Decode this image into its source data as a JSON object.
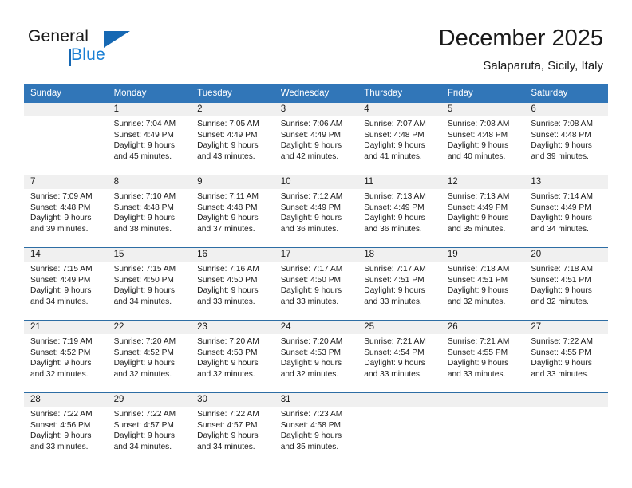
{
  "brand": {
    "name_part1": "General",
    "name_part2": "Blue",
    "logo_icon": "triangle-logo-icon"
  },
  "header": {
    "month_title": "December 2025",
    "location": "Salaparuta, Sicily, Italy"
  },
  "colors": {
    "header_blue": "#3176b8",
    "row_divider_blue": "#2d6da4",
    "daynum_band": "#f0f0f0",
    "brand_blue": "#1a7fd4",
    "logo_blue": "#1668b3"
  },
  "weekday_headers": [
    "Sunday",
    "Monday",
    "Tuesday",
    "Wednesday",
    "Thursday",
    "Friday",
    "Saturday"
  ],
  "weeks": [
    [
      {
        "day": "",
        "blank": true,
        "sunrise": "",
        "sunset": "",
        "daylight_line1": "",
        "daylight_line2": ""
      },
      {
        "day": "1",
        "sunrise": "Sunrise: 7:04 AM",
        "sunset": "Sunset: 4:49 PM",
        "daylight_line1": "Daylight: 9 hours",
        "daylight_line2": "and 45 minutes."
      },
      {
        "day": "2",
        "sunrise": "Sunrise: 7:05 AM",
        "sunset": "Sunset: 4:49 PM",
        "daylight_line1": "Daylight: 9 hours",
        "daylight_line2": "and 43 minutes."
      },
      {
        "day": "3",
        "sunrise": "Sunrise: 7:06 AM",
        "sunset": "Sunset: 4:49 PM",
        "daylight_line1": "Daylight: 9 hours",
        "daylight_line2": "and 42 minutes."
      },
      {
        "day": "4",
        "sunrise": "Sunrise: 7:07 AM",
        "sunset": "Sunset: 4:48 PM",
        "daylight_line1": "Daylight: 9 hours",
        "daylight_line2": "and 41 minutes."
      },
      {
        "day": "5",
        "sunrise": "Sunrise: 7:08 AM",
        "sunset": "Sunset: 4:48 PM",
        "daylight_line1": "Daylight: 9 hours",
        "daylight_line2": "and 40 minutes."
      },
      {
        "day": "6",
        "sunrise": "Sunrise: 7:08 AM",
        "sunset": "Sunset: 4:48 PM",
        "daylight_line1": "Daylight: 9 hours",
        "daylight_line2": "and 39 minutes."
      }
    ],
    [
      {
        "day": "7",
        "sunrise": "Sunrise: 7:09 AM",
        "sunset": "Sunset: 4:48 PM",
        "daylight_line1": "Daylight: 9 hours",
        "daylight_line2": "and 39 minutes."
      },
      {
        "day": "8",
        "sunrise": "Sunrise: 7:10 AM",
        "sunset": "Sunset: 4:48 PM",
        "daylight_line1": "Daylight: 9 hours",
        "daylight_line2": "and 38 minutes."
      },
      {
        "day": "9",
        "sunrise": "Sunrise: 7:11 AM",
        "sunset": "Sunset: 4:48 PM",
        "daylight_line1": "Daylight: 9 hours",
        "daylight_line2": "and 37 minutes."
      },
      {
        "day": "10",
        "sunrise": "Sunrise: 7:12 AM",
        "sunset": "Sunset: 4:49 PM",
        "daylight_line1": "Daylight: 9 hours",
        "daylight_line2": "and 36 minutes."
      },
      {
        "day": "11",
        "sunrise": "Sunrise: 7:13 AM",
        "sunset": "Sunset: 4:49 PM",
        "daylight_line1": "Daylight: 9 hours",
        "daylight_line2": "and 36 minutes."
      },
      {
        "day": "12",
        "sunrise": "Sunrise: 7:13 AM",
        "sunset": "Sunset: 4:49 PM",
        "daylight_line1": "Daylight: 9 hours",
        "daylight_line2": "and 35 minutes."
      },
      {
        "day": "13",
        "sunrise": "Sunrise: 7:14 AM",
        "sunset": "Sunset: 4:49 PM",
        "daylight_line1": "Daylight: 9 hours",
        "daylight_line2": "and 34 minutes."
      }
    ],
    [
      {
        "day": "14",
        "sunrise": "Sunrise: 7:15 AM",
        "sunset": "Sunset: 4:49 PM",
        "daylight_line1": "Daylight: 9 hours",
        "daylight_line2": "and 34 minutes."
      },
      {
        "day": "15",
        "sunrise": "Sunrise: 7:15 AM",
        "sunset": "Sunset: 4:50 PM",
        "daylight_line1": "Daylight: 9 hours",
        "daylight_line2": "and 34 minutes."
      },
      {
        "day": "16",
        "sunrise": "Sunrise: 7:16 AM",
        "sunset": "Sunset: 4:50 PM",
        "daylight_line1": "Daylight: 9 hours",
        "daylight_line2": "and 33 minutes."
      },
      {
        "day": "17",
        "sunrise": "Sunrise: 7:17 AM",
        "sunset": "Sunset: 4:50 PM",
        "daylight_line1": "Daylight: 9 hours",
        "daylight_line2": "and 33 minutes."
      },
      {
        "day": "18",
        "sunrise": "Sunrise: 7:17 AM",
        "sunset": "Sunset: 4:51 PM",
        "daylight_line1": "Daylight: 9 hours",
        "daylight_line2": "and 33 minutes."
      },
      {
        "day": "19",
        "sunrise": "Sunrise: 7:18 AM",
        "sunset": "Sunset: 4:51 PM",
        "daylight_line1": "Daylight: 9 hours",
        "daylight_line2": "and 32 minutes."
      },
      {
        "day": "20",
        "sunrise": "Sunrise: 7:18 AM",
        "sunset": "Sunset: 4:51 PM",
        "daylight_line1": "Daylight: 9 hours",
        "daylight_line2": "and 32 minutes."
      }
    ],
    [
      {
        "day": "21",
        "sunrise": "Sunrise: 7:19 AM",
        "sunset": "Sunset: 4:52 PM",
        "daylight_line1": "Daylight: 9 hours",
        "daylight_line2": "and 32 minutes."
      },
      {
        "day": "22",
        "sunrise": "Sunrise: 7:20 AM",
        "sunset": "Sunset: 4:52 PM",
        "daylight_line1": "Daylight: 9 hours",
        "daylight_line2": "and 32 minutes."
      },
      {
        "day": "23",
        "sunrise": "Sunrise: 7:20 AM",
        "sunset": "Sunset: 4:53 PM",
        "daylight_line1": "Daylight: 9 hours",
        "daylight_line2": "and 32 minutes."
      },
      {
        "day": "24",
        "sunrise": "Sunrise: 7:20 AM",
        "sunset": "Sunset: 4:53 PM",
        "daylight_line1": "Daylight: 9 hours",
        "daylight_line2": "and 32 minutes."
      },
      {
        "day": "25",
        "sunrise": "Sunrise: 7:21 AM",
        "sunset": "Sunset: 4:54 PM",
        "daylight_line1": "Daylight: 9 hours",
        "daylight_line2": "and 33 minutes."
      },
      {
        "day": "26",
        "sunrise": "Sunrise: 7:21 AM",
        "sunset": "Sunset: 4:55 PM",
        "daylight_line1": "Daylight: 9 hours",
        "daylight_line2": "and 33 minutes."
      },
      {
        "day": "27",
        "sunrise": "Sunrise: 7:22 AM",
        "sunset": "Sunset: 4:55 PM",
        "daylight_line1": "Daylight: 9 hours",
        "daylight_line2": "and 33 minutes."
      }
    ],
    [
      {
        "day": "28",
        "sunrise": "Sunrise: 7:22 AM",
        "sunset": "Sunset: 4:56 PM",
        "daylight_line1": "Daylight: 9 hours",
        "daylight_line2": "and 33 minutes."
      },
      {
        "day": "29",
        "sunrise": "Sunrise: 7:22 AM",
        "sunset": "Sunset: 4:57 PM",
        "daylight_line1": "Daylight: 9 hours",
        "daylight_line2": "and 34 minutes."
      },
      {
        "day": "30",
        "sunrise": "Sunrise: 7:22 AM",
        "sunset": "Sunset: 4:57 PM",
        "daylight_line1": "Daylight: 9 hours",
        "daylight_line2": "and 34 minutes."
      },
      {
        "day": "31",
        "sunrise": "Sunrise: 7:23 AM",
        "sunset": "Sunset: 4:58 PM",
        "daylight_line1": "Daylight: 9 hours",
        "daylight_line2": "and 35 minutes."
      },
      {
        "day": "",
        "blank": true,
        "sunrise": "",
        "sunset": "",
        "daylight_line1": "",
        "daylight_line2": ""
      },
      {
        "day": "",
        "blank": true,
        "sunrise": "",
        "sunset": "",
        "daylight_line1": "",
        "daylight_line2": ""
      },
      {
        "day": "",
        "blank": true,
        "sunrise": "",
        "sunset": "",
        "daylight_line1": "",
        "daylight_line2": ""
      }
    ]
  ]
}
